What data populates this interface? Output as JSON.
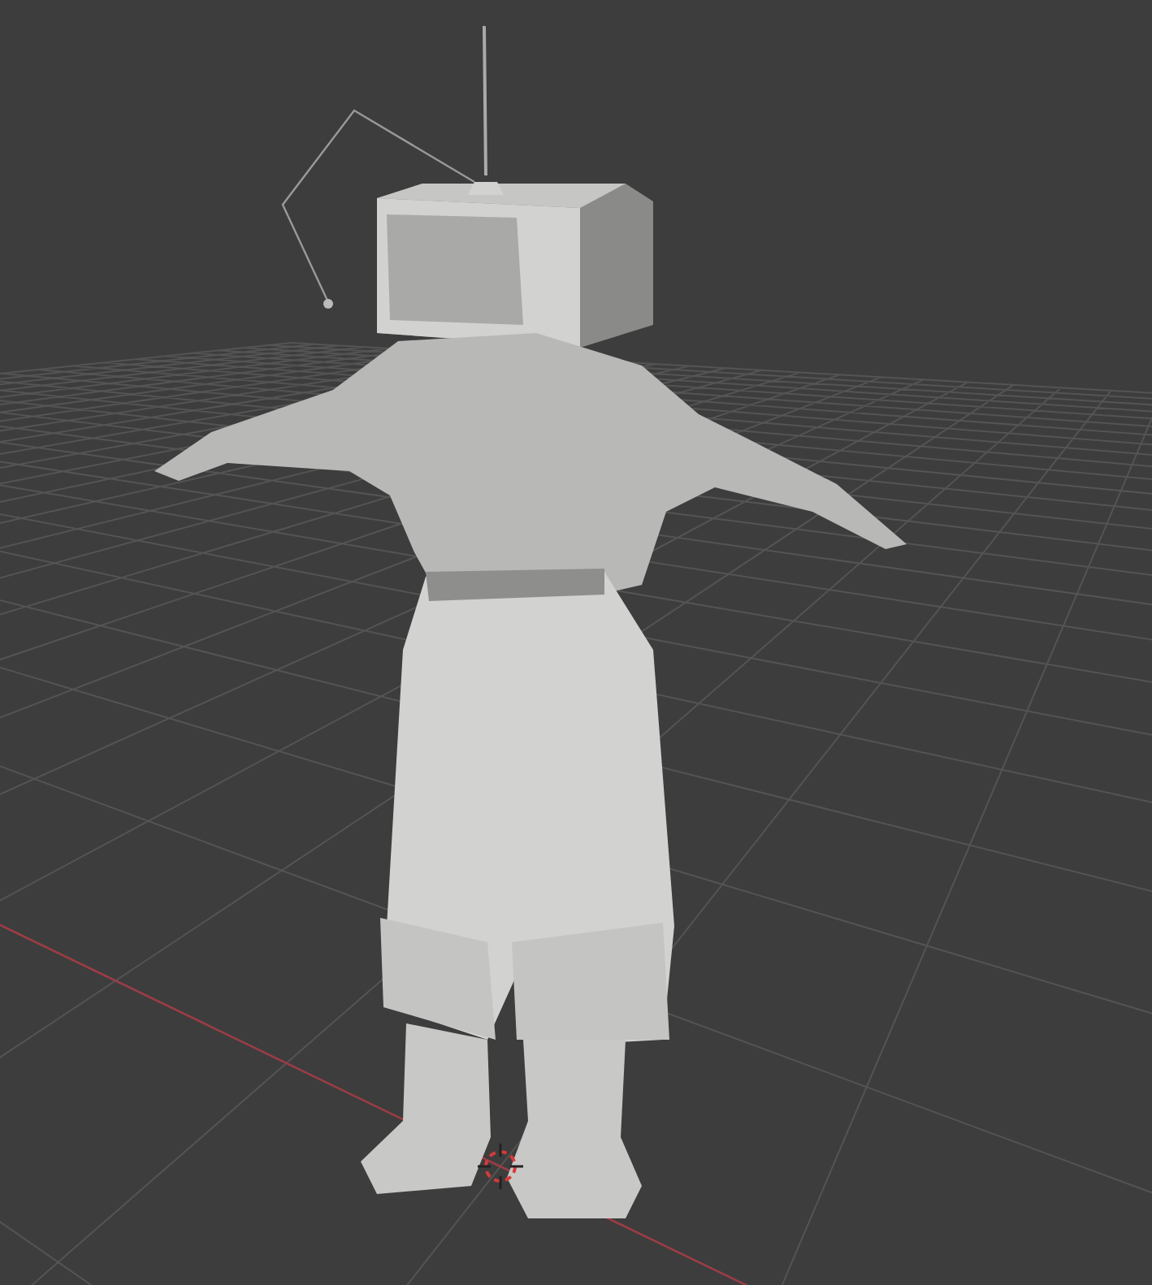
{
  "viewport": {
    "grid": true,
    "x_axis": true,
    "cursor_3d": true
  }
}
